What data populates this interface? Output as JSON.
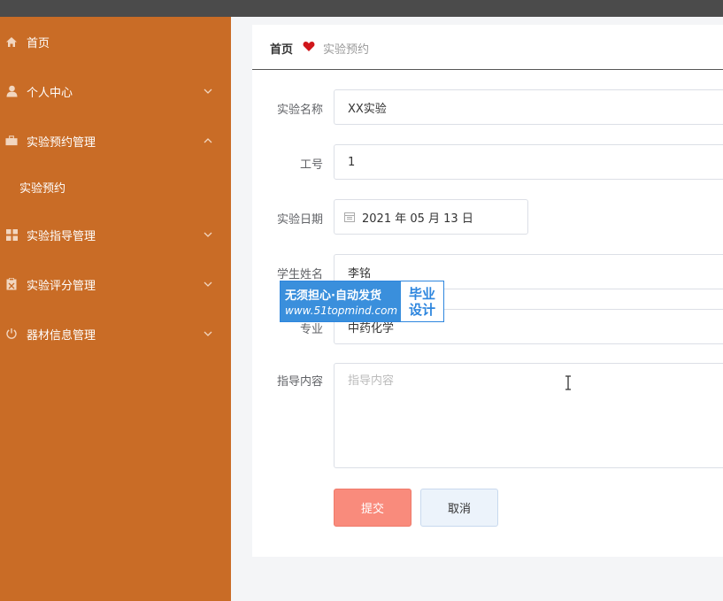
{
  "sidebar": {
    "items": [
      {
        "label": "首页",
        "icon": "home-icon"
      },
      {
        "label": "个人中心",
        "icon": "user-icon"
      },
      {
        "label": "实验预约管理",
        "icon": "briefcase-icon"
      },
      {
        "label": "实验指导管理",
        "icon": "grid-icon"
      },
      {
        "label": "实验评分管理",
        "icon": "clipboard-icon"
      },
      {
        "label": "器材信息管理",
        "icon": "power-icon"
      }
    ],
    "sub_items": [
      {
        "label": "实验预约"
      }
    ],
    "bg_color": "#c96c26"
  },
  "breadcrumb": {
    "home": "首页",
    "current": "实验预约"
  },
  "form": {
    "fields": [
      {
        "label": "实验名称",
        "value": "XX实验"
      },
      {
        "label": "工号",
        "value": "1"
      },
      {
        "label": "实验日期",
        "value": "2021 年 05 月 13 日"
      },
      {
        "label": "学生姓名",
        "value": "李铭"
      },
      {
        "label": "专业",
        "value": "中药化学"
      },
      {
        "label": "指导内容",
        "placeholder": "指导内容"
      }
    ],
    "submit_label": "提交",
    "cancel_label": "取消"
  },
  "watermark": {
    "line1": "无须担心·自动发货",
    "line2": "www.51topmind.com",
    "right_line1": "毕业",
    "right_line2": "设计"
  }
}
